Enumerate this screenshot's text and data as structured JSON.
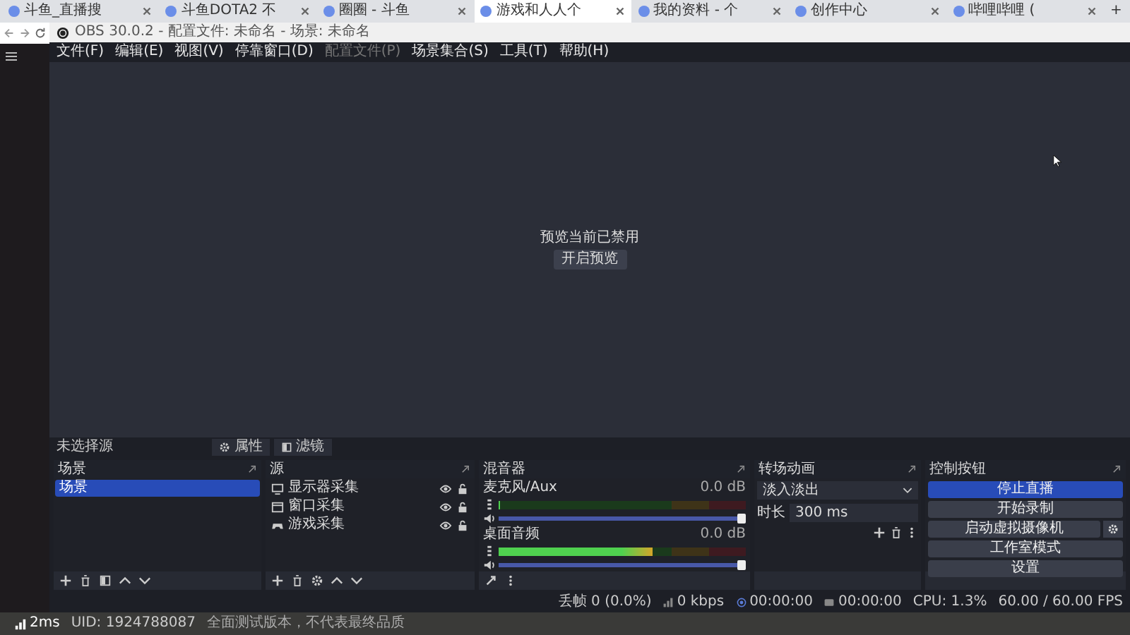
{
  "browser": {
    "tabs": [
      {
        "title": "斗鱼_直播搜",
        "selected": false
      },
      {
        "title": "斗鱼DOTA2 不",
        "selected": false
      },
      {
        "title": "圈圈 - 斗鱼",
        "selected": false
      },
      {
        "title": "游戏和人人个",
        "selected": true
      },
      {
        "title": "我的资料 - 个",
        "selected": false
      },
      {
        "title": "创作中心",
        "selected": false
      },
      {
        "title": "哔哩哔哩 (",
        "selected": false
      }
    ],
    "new_tab": "+"
  },
  "obs": {
    "title": "OBS 30.0.2 - 配置文件: 未命名 - 场景: 未命名",
    "menu": [
      {
        "label": "文件(F)",
        "disabled": false
      },
      {
        "label": "编辑(E)",
        "disabled": false
      },
      {
        "label": "视图(V)",
        "disabled": false
      },
      {
        "label": "停靠窗口(D)",
        "disabled": false
      },
      {
        "label": "配置文件(P)",
        "disabled": true
      },
      {
        "label": "场景集合(S)",
        "disabled": false
      },
      {
        "label": "工具(T)",
        "disabled": false
      },
      {
        "label": "帮助(H)",
        "disabled": false
      }
    ],
    "preview": {
      "message": "预览当前已禁用",
      "button": "开启预览"
    },
    "context_bar": {
      "label": "未选择源",
      "buttons": [
        "属性",
        "滤镜"
      ]
    },
    "scenes": {
      "title": "场景",
      "items": [
        {
          "name": "场景",
          "selected": true
        }
      ]
    },
    "sources": {
      "title": "源",
      "items": [
        {
          "name": "显示器采集",
          "kind": "monitor",
          "visible": true,
          "locked": false
        },
        {
          "name": "窗口采集",
          "kind": "window",
          "visible": true,
          "locked": false
        },
        {
          "name": "游戏采集",
          "kind": "game",
          "visible": true,
          "locked": false
        }
      ]
    },
    "mixer": {
      "title": "混音器",
      "channels": [
        {
          "name": "麦克风/Aux",
          "reading": "0.0 dB",
          "meter": {
            "level": 0.0
          },
          "fader": {
            "level": 1.0
          }
        },
        {
          "name": "桌面音频",
          "reading": "0.0 dB",
          "meter": {
            "level": 0.62
          },
          "fader": {
            "level": 1.0
          }
        }
      ]
    },
    "transitions": {
      "title": "转场动画",
      "transition": "淡入淡出",
      "duration_label": "时长",
      "duration": "300 ms"
    },
    "controls": {
      "title": "控制按钮",
      "buttons": [
        {
          "label": "停止直播",
          "active": true,
          "settings": false
        },
        {
          "label": "开始录制",
          "active": false,
          "settings": false
        },
        {
          "label": "启动虚拟摄像机",
          "active": false,
          "settings": true
        },
        {
          "label": "工作室模式",
          "active": false,
          "settings": false
        },
        {
          "label": "设置",
          "active": false,
          "settings": false
        }
      ]
    },
    "status_bar": {
      "dropped": "丢帧 0 (0.0%)",
      "bitrate": "0 kbps",
      "stream_time": "00:00:00",
      "record_time": "00:00:00",
      "cpu": "CPU: 1.3%",
      "fps": "60.00 / 60.00 FPS"
    }
  },
  "overlay": {
    "ping": "2ms",
    "uid": "UID: 1924788087",
    "notice": "全面测试版本，不代表最终品质"
  }
}
